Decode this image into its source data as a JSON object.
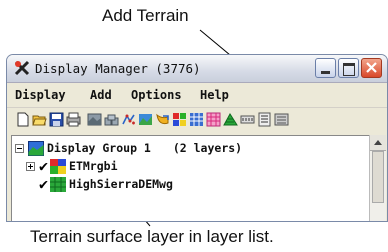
{
  "callouts": {
    "top": "Add Terrain",
    "bottom": "Terrain surface layer in layer list."
  },
  "window": {
    "title": "Display Manager (3776)"
  },
  "menu": [
    "Display",
    "Add",
    "Options",
    "Help"
  ],
  "toolbar": {
    "icons": [
      "new-icon",
      "open-icon",
      "save-icon",
      "print-icon",
      "add-raster-icon",
      "add-multi-raster-icon",
      "add-vector-icon",
      "add-geometric-icon",
      "add-shape-icon",
      "add-color-icon",
      "add-db-icon",
      "add-terrain-icon",
      "add-surface-icon",
      "add-text-icon",
      "add-legend-icon",
      "add-map-grid-icon"
    ]
  },
  "layers": {
    "group": {
      "name": "Display Group 1",
      "count": "(2 layers)"
    },
    "items": [
      {
        "name": "ETMrgbi",
        "checked": true,
        "expanded": false
      },
      {
        "name": "HighSierraDEMwg",
        "checked": true,
        "expanded": false
      }
    ]
  },
  "colors": {
    "accent": "#2e6ed8",
    "close": "#d9482a"
  }
}
